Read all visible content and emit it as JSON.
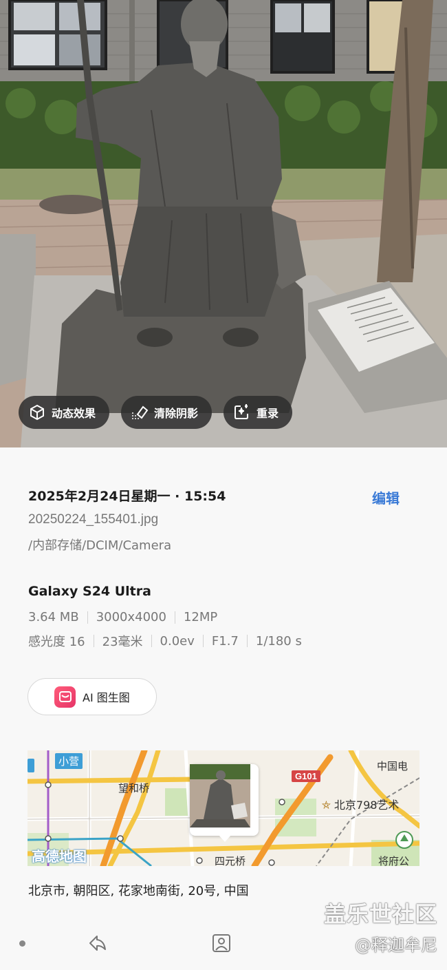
{
  "photo": {
    "actions": [
      {
        "label": "动态效果",
        "icon": "cube-motion-icon"
      },
      {
        "label": "清除阴影",
        "icon": "eraser-shadow-icon"
      },
      {
        "label": "重录",
        "icon": "sparkle-rerecord-icon"
      }
    ]
  },
  "details": {
    "datetime": "2025年2月24日星期一 · 15:54",
    "edit_label": "编辑",
    "filename": "20250224_155401.jpg",
    "path": "/内部存储/DCIM/Camera",
    "device": "Galaxy S24 Ultra",
    "file_specs": [
      "3.64 MB",
      "3000x4000",
      "12MP"
    ],
    "camera_specs": [
      "感光度 16",
      "23毫米",
      "0.0ev",
      "F1.7",
      "1/180 s"
    ],
    "ai_button_label": "AI 图生图"
  },
  "map": {
    "labels": {
      "xiaoying": "小营",
      "wanghe": "望和桥",
      "g101": "G101",
      "china_tel": "中国电",
      "art798": "北京798艺术",
      "gaode": "高德地图",
      "sihuan": "四元桥",
      "jiangfu": "将府公"
    }
  },
  "address": "北京市, 朝阳区, 花家地南街, 20号, 中国",
  "watermark": {
    "line1": "盖乐世社区",
    "line2": "@释迦牟尼"
  },
  "nav": {
    "icons": [
      "share-icon",
      "portrait-icon"
    ]
  },
  "colors": {
    "accent": "#3a7ad6",
    "chip_bg": "#2d2d2d"
  }
}
